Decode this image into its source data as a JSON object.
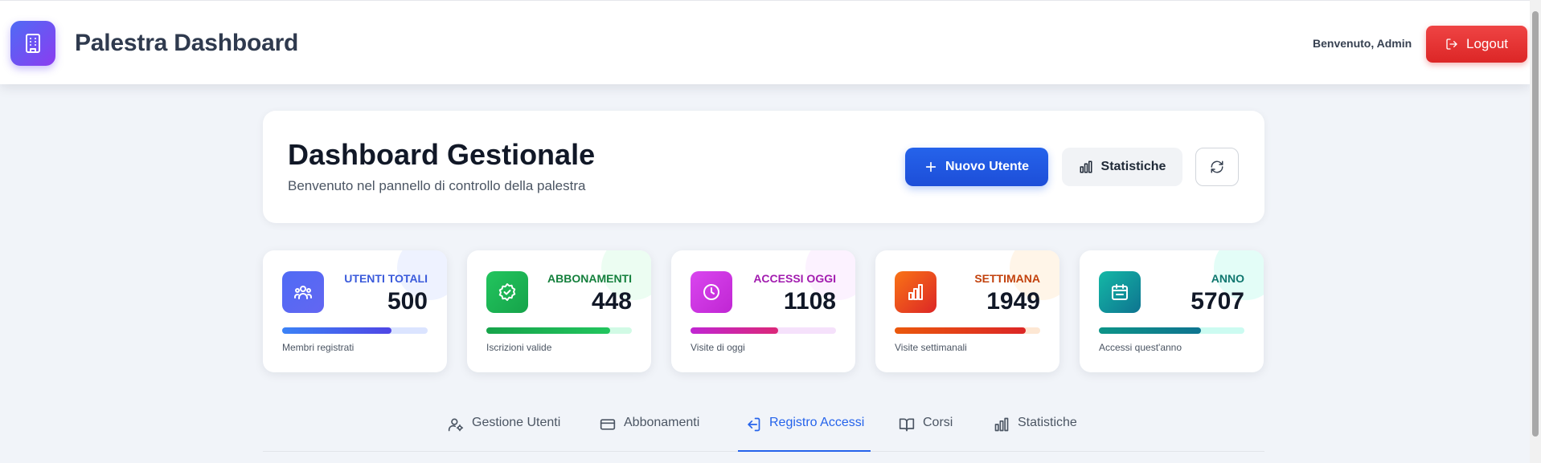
{
  "header": {
    "title": "Palestra Dashboard",
    "welcome": "Benvenuto, Admin",
    "logout_label": "Logout"
  },
  "dashboard": {
    "title": "Dashboard Gestionale",
    "subtitle": "Benvenuto nel pannello di controllo della palestra",
    "new_user_label": "Nuovo Utente",
    "stats_label": "Statistiche"
  },
  "stats": [
    {
      "label": "UTENTI TOTALI",
      "value": "500",
      "caption": "Membri registrati",
      "progress": 0.75,
      "icon": "users-icon",
      "color": "#4f6bf5"
    },
    {
      "label": "ABBONAMENTI",
      "value": "448",
      "caption": "Iscrizioni valide",
      "progress": 0.85,
      "icon": "badge-check-icon",
      "color": "#16a34a"
    },
    {
      "label": "ACCESSI OGGI",
      "value": "1108",
      "caption": "Visite di oggi",
      "progress": 0.6,
      "icon": "clock-icon",
      "color": "#c026d3"
    },
    {
      "label": "SETTIMANA",
      "value": "1949",
      "caption": "Visite settimanali",
      "progress": 0.9,
      "icon": "bar-chart-icon",
      "color": "#ea580c"
    },
    {
      "label": "ANNO",
      "value": "5707",
      "caption": "Accessi quest'anno",
      "progress": 0.7,
      "icon": "calendar-icon",
      "color": "#0d9488"
    }
  ],
  "tabs": [
    {
      "label": "Gestione Utenti",
      "icon": "user-cog-icon",
      "active": false
    },
    {
      "label": "Abbonamenti",
      "icon": "credit-card-icon",
      "active": false
    },
    {
      "label": "Registro Accessi",
      "icon": "log-in-icon",
      "active": true
    },
    {
      "label": "Corsi",
      "icon": "book-open-icon",
      "active": false
    },
    {
      "label": "Statistiche",
      "icon": "bar-chart-icon",
      "active": false
    }
  ],
  "colors": {
    "primary": "#2563eb",
    "danger": "#dc2626",
    "brand_gradient_start": "#4f6bf5",
    "brand_gradient_end": "#8b3cf0"
  }
}
